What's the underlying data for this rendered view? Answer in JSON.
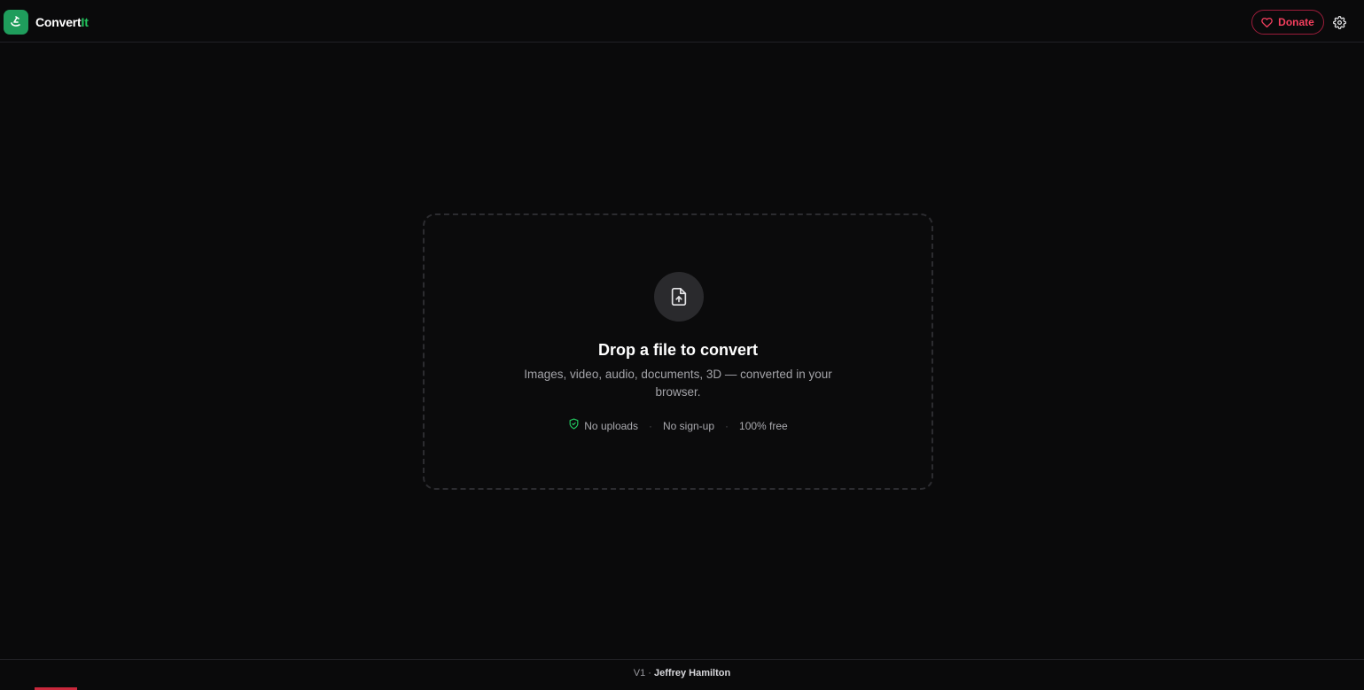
{
  "header": {
    "brand_part1": "Convert",
    "brand_part2": "It",
    "donate_label": "Donate"
  },
  "dropzone": {
    "title": "Drop a file to convert",
    "subtitle": "Images, video, audio, documents, 3D — converted in your browser.",
    "features": [
      "No uploads",
      "No sign-up",
      "100% free"
    ],
    "separator": "·"
  },
  "footer": {
    "version": "V1",
    "separator": " · ",
    "author": "Jeffrey Hamilton"
  },
  "colors": {
    "background": "#0a0a0b",
    "brand_green": "#22c55e",
    "logo_bg": "#1f9d5c",
    "donate_accent": "#f43f5e"
  },
  "icons": {
    "logo": "convert-arrows-icon",
    "donate": "heart-icon",
    "settings": "gear-icon",
    "upload": "file-upload-icon",
    "feature": "shield-check-icon"
  }
}
